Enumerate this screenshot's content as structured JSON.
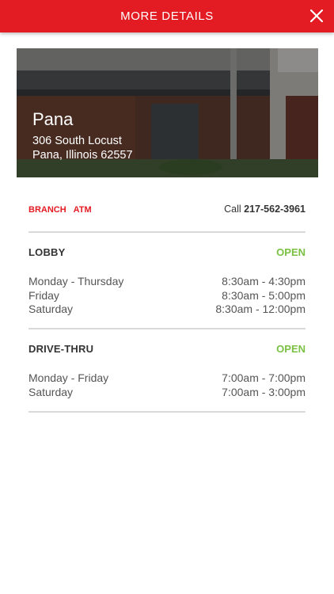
{
  "header": {
    "title": "MORE DETAILS",
    "close_icon": "close-icon",
    "color": "#e31b23"
  },
  "branch": {
    "name": "Pana",
    "address_line1": "306 South Locust",
    "address_line2": "Pana, Illinois 62557"
  },
  "tags": [
    "BRANCH",
    "ATM"
  ],
  "call": {
    "label": "Call",
    "phone": "217-562-3961"
  },
  "lobby": {
    "title": "LOBBY",
    "status": "OPEN",
    "hours": [
      {
        "days": "Monday - Thursday",
        "time": "8:30am - 4:30pm"
      },
      {
        "days": "Friday",
        "time": "8:30am - 5:00pm"
      },
      {
        "days": "Saturday",
        "time": "8:30am - 12:00pm"
      }
    ]
  },
  "drive_thru": {
    "title": "DRIVE-THRU",
    "status": "OPEN",
    "hours": [
      {
        "days": "Monday - Friday",
        "time": "7:00am - 7:00pm"
      },
      {
        "days": "Saturday",
        "time": "7:00am - 3:00pm"
      }
    ]
  },
  "colors": {
    "accent": "#e31b23",
    "open": "#7ac143"
  }
}
